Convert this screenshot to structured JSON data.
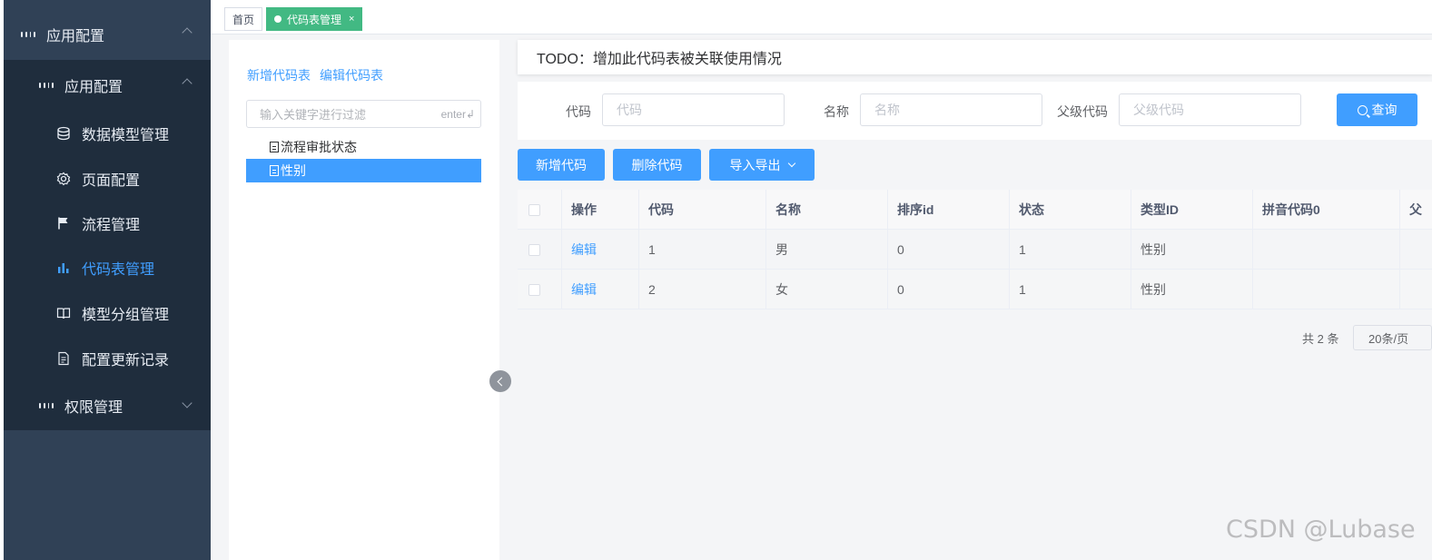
{
  "sidebar": {
    "top_group": "应用配置",
    "sub_group": "应用配置",
    "items": [
      {
        "label": "数据模型管理",
        "icon": "database-icon"
      },
      {
        "label": "页面配置",
        "icon": "gear-icon"
      },
      {
        "label": "流程管理",
        "icon": "flag-icon"
      },
      {
        "label": "代码表管理",
        "icon": "bar-chart-icon"
      },
      {
        "label": "模型分组管理",
        "icon": "book-icon"
      },
      {
        "label": "配置更新记录",
        "icon": "document-icon"
      }
    ],
    "permission_group": "权限管理",
    "active_color": "#409eff",
    "bg_color": "#304156"
  },
  "tags": {
    "home": "首页",
    "active": "代码表管理",
    "close": "×"
  },
  "tree": {
    "add_label": "新增代码表",
    "edit_label": "编辑代码表",
    "search_placeholder": "输入关键字进行过滤",
    "search_hint": "enter↲",
    "nodes": [
      "流程审批状态",
      "性别"
    ]
  },
  "todo": "TODO：增加此代码表被关联使用情况",
  "form": {
    "code_label": "代码",
    "code_placeholder": "代码",
    "name_label": "名称",
    "name_placeholder": "名称",
    "parent_label": "父级代码",
    "parent_placeholder": "父级代码",
    "query_label": "查询"
  },
  "toolbar": {
    "add_code": "新增代码",
    "delete_code": "删除代码",
    "import_export": "导入导出"
  },
  "table": {
    "headers": [
      "操作",
      "代码",
      "名称",
      "排序id",
      "状态",
      "类型ID",
      "拼音代码0",
      "父"
    ],
    "rows": [
      {
        "action": "编辑",
        "code": "1",
        "name": "男",
        "sort": "0",
        "status": "1",
        "type": "性别",
        "pinyin": "",
        "parent": ""
      },
      {
        "action": "编辑",
        "code": "2",
        "name": "女",
        "sort": "0",
        "status": "1",
        "type": "性别",
        "pinyin": "",
        "parent": ""
      }
    ]
  },
  "pagination": {
    "total": "共 2 条",
    "page_size": "20条/页"
  },
  "watermark": "CSDN @Lubase"
}
